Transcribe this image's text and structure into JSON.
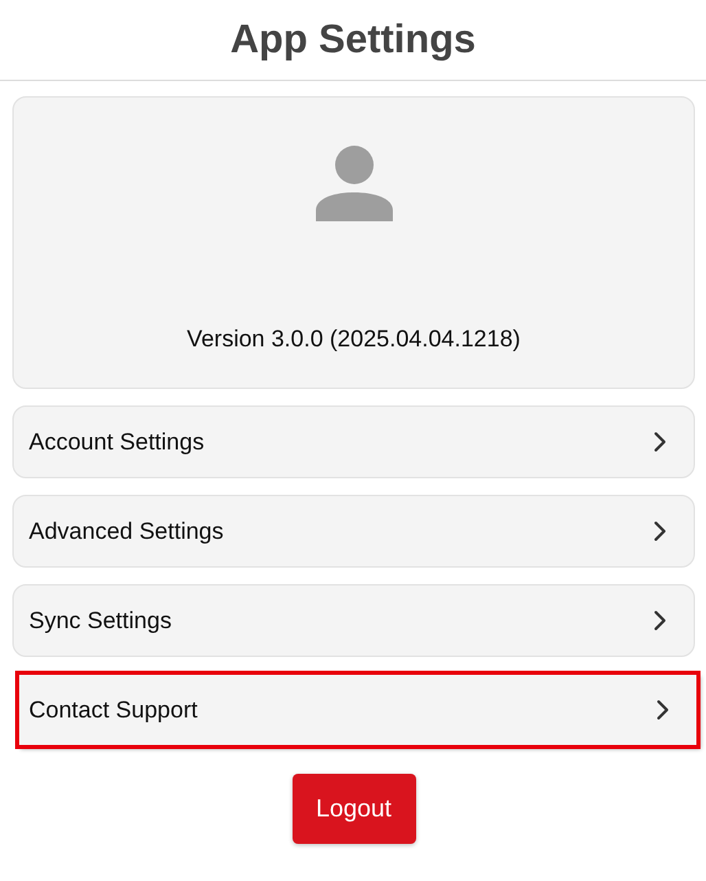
{
  "header": {
    "title": "App Settings"
  },
  "profile_card": {
    "version": "Version 3.0.0 (2025.04.04.1218)"
  },
  "menu_items": [
    {
      "label": "Account Settings",
      "highlighted": false
    },
    {
      "label": "Advanced Settings",
      "highlighted": false
    },
    {
      "label": "Sync Settings",
      "highlighted": false
    },
    {
      "label": "Contact Support",
      "highlighted": true
    }
  ],
  "logout_button": {
    "label": "Logout"
  }
}
